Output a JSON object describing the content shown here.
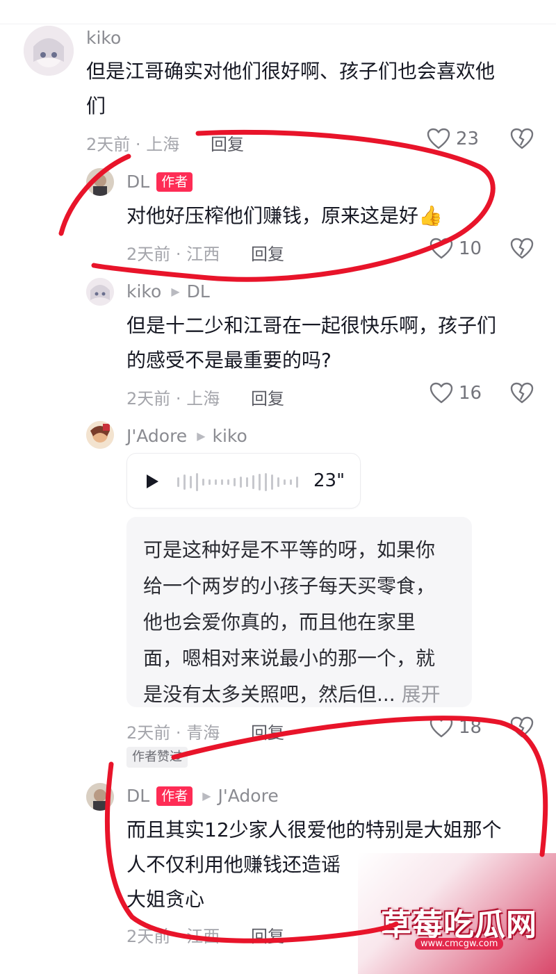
{
  "comments": [
    {
      "user": "kiko",
      "text_lines": [
        "但是江哥确实对他们很好啊、孩子们也会喜欢他",
        "们"
      ],
      "time": "2天前",
      "location": "上海",
      "reply": "回复",
      "likes": "23"
    },
    {
      "user": "DL",
      "author_badge": "作者",
      "text": "对他好压榨他们赚钱，原来这是好",
      "emoji": "👍",
      "time": "2天前",
      "location": "江西",
      "reply": "回复",
      "likes": "10"
    },
    {
      "user": "kiko",
      "reply_to": "DL",
      "text_lines": [
        "但是十二少和江哥在一起很快乐啊，孩子们",
        "的感受不是最重要的吗?"
      ],
      "time": "2天前",
      "location": "上海",
      "reply": "回复",
      "likes": "16"
    },
    {
      "user": "J'Adore",
      "reply_to": "kiko",
      "voice_duration": "23\"",
      "transcript_lines": [
        "可是这种好是不平等的呀，如果你",
        "给一个两岁的小孩子每天买零食，",
        "他也会爱你真的，而且他在家里",
        "面，嗯相对来说最小的那一个，就",
        "是没有太多关照吧，然后但..."
      ],
      "expand": "展开",
      "time": "2天前",
      "location": "青海",
      "reply": "回复",
      "likes": "18",
      "author_liked": "作者赞过"
    },
    {
      "user": "DL",
      "author_badge": "作者",
      "reply_to": "J'Adore",
      "text_lines": [
        "而且其实12少家人很爱他的特别是大姐那个",
        "人不仅利用他赚钱还造谣",
        "大姐贪心"
      ],
      "time": "2天前",
      "location": "江西",
      "reply": "回复"
    }
  ],
  "meta_sep": "·",
  "watermark": {
    "title": "草莓吃瓜网",
    "url": "www.cmcgw.com"
  },
  "colors": {
    "accent": "#fe2c55",
    "ink": "#e8142a"
  }
}
